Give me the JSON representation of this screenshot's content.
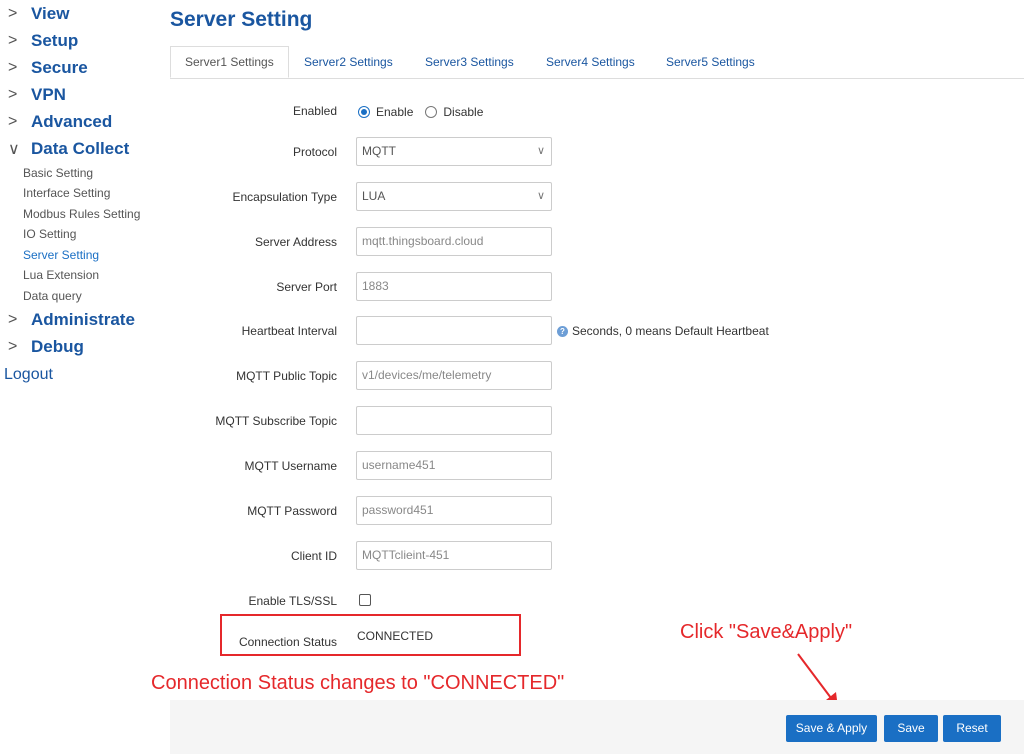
{
  "sidebar": {
    "top_items": [
      {
        "label": "View"
      },
      {
        "label": "Setup"
      },
      {
        "label": "Secure"
      },
      {
        "label": "VPN"
      },
      {
        "label": "Advanced"
      },
      {
        "label": "Data Collect"
      },
      {
        "label": "Administrate"
      },
      {
        "label": "Debug"
      }
    ],
    "sub_items": [
      {
        "label": "Basic Setting"
      },
      {
        "label": "Interface Setting"
      },
      {
        "label": "Modbus Rules Setting"
      },
      {
        "label": "IO Setting"
      },
      {
        "label": "Server Setting"
      },
      {
        "label": "Lua Extension"
      },
      {
        "label": "Data query"
      }
    ],
    "logout": "Logout"
  },
  "page": {
    "title": "Server Setting"
  },
  "tabs": [
    {
      "label": "Server1 Settings"
    },
    {
      "label": "Server2 Settings"
    },
    {
      "label": "Server3 Settings"
    },
    {
      "label": "Server4 Settings"
    },
    {
      "label": "Server5 Settings"
    }
  ],
  "form": {
    "enabled": {
      "label": "Enabled",
      "enable": "Enable",
      "disable": "Disable"
    },
    "protocol": {
      "label": "Protocol",
      "value": "MQTT"
    },
    "encapsulation": {
      "label": "Encapsulation Type",
      "value": "LUA"
    },
    "server_address": {
      "label": "Server Address",
      "value": "mqtt.thingsboard.cloud"
    },
    "server_port": {
      "label": "Server Port",
      "value": "1883"
    },
    "heartbeat": {
      "label": "Heartbeat Interval",
      "value": "",
      "hint": "Seconds, 0 means Default Heartbeat"
    },
    "public_topic": {
      "label": "MQTT Public Topic",
      "value": "v1/devices/me/telemetry"
    },
    "subscribe_topic": {
      "label": "MQTT Subscribe Topic",
      "value": ""
    },
    "username": {
      "label": "MQTT Username",
      "value": "username451"
    },
    "password": {
      "label": "MQTT Password",
      "value": "password451"
    },
    "client_id": {
      "label": "Client ID",
      "value": "MQTTclieint-451"
    },
    "tls": {
      "label": "Enable TLS/SSL"
    },
    "connection_status": {
      "label": "Connection Status",
      "value": "CONNECTED"
    }
  },
  "annotations": {
    "click_hint": "Click \"Save&Apply\"",
    "status_hint": "Connection Status changes to \"CONNECTED\"",
    "color": "#e5282b"
  },
  "buttons": {
    "save_apply": "Save & Apply",
    "save": "Save",
    "reset": "Reset"
  },
  "colors": {
    "accent": "#1a6fc4",
    "title": "#1a56a0"
  }
}
